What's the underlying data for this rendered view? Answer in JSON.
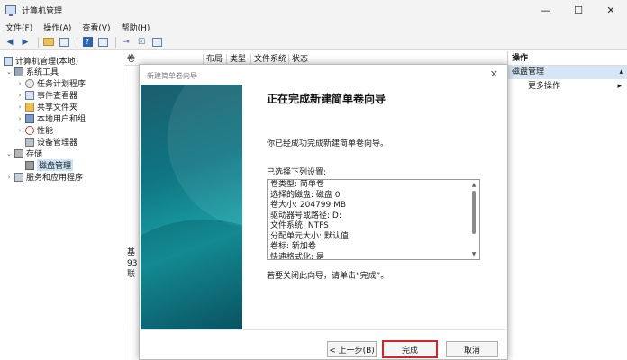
{
  "window": {
    "title": "计算机管理",
    "controls": [
      "—",
      "☐",
      "✕"
    ]
  },
  "menu": [
    "文件(F)",
    "操作(A)",
    "查看(V)",
    "帮助(H)"
  ],
  "tree": {
    "root": "计算机管理(本地)",
    "system_tools": "系统工具",
    "task_scheduler": "任务计划程序",
    "event_viewer": "事件查看器",
    "shared_folders": "共享文件夹",
    "local_users": "本地用户和组",
    "performance": "性能",
    "device_manager": "设备管理器",
    "storage": "存储",
    "disk_management": "磁盘管理",
    "services_apps": "服务和应用程序"
  },
  "columns": [
    "卷",
    "布局",
    "类型",
    "文件系统",
    "状态"
  ],
  "lower_pane": [
    "基",
    "93",
    "联"
  ],
  "actions": {
    "header": "操作",
    "section": "磁盘管理",
    "more": "更多操作"
  },
  "wizard": {
    "title": "新建简单卷向导",
    "close": "✕",
    "heading": "正在完成新建简单卷向导",
    "message": "你已经成功完成新建简单卷向导。",
    "settings_label": "已选择下列设置:",
    "settings": [
      "卷类型: 简单卷",
      "选择的磁盘: 磁盘 0",
      "卷大小: 204799 MB",
      "驱动器号或路径: D:",
      "文件系统: NTFS",
      "分配单元大小: 默认值",
      "卷标: 新加卷",
      "快速格式化: 是"
    ],
    "close_msg": "若要关闭此向导，请单击“完成”。",
    "back_label": "< 上一步(B)",
    "finish_label": "完成",
    "cancel_label": "取消"
  }
}
